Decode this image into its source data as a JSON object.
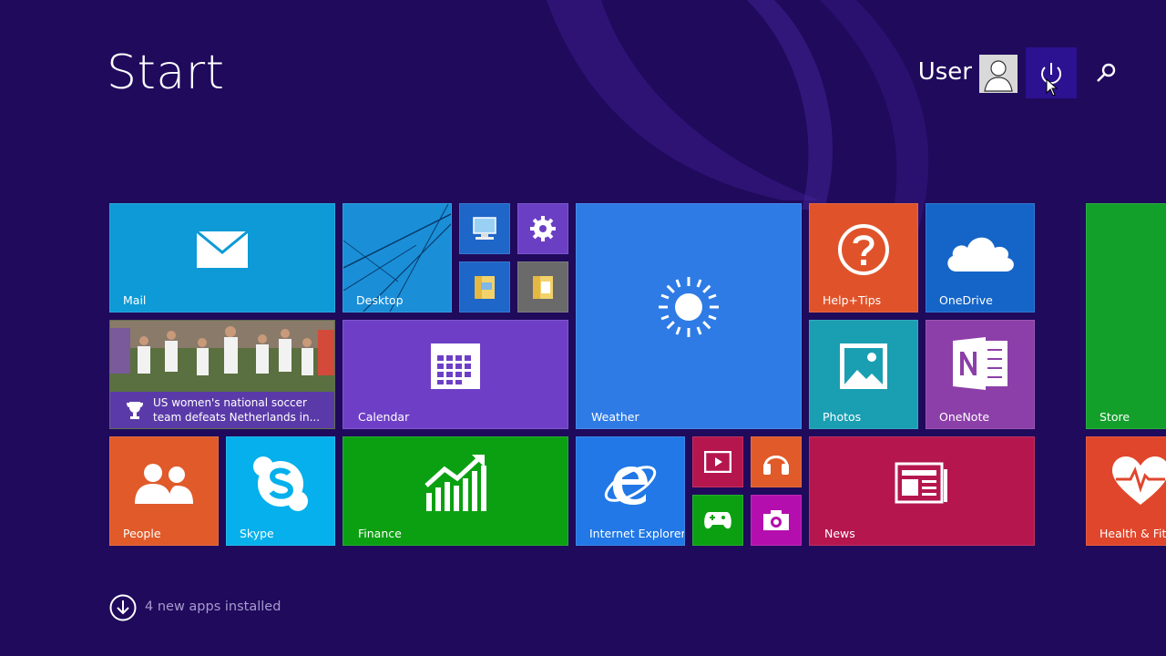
{
  "header": {
    "title": "Start",
    "user_name": "User"
  },
  "tiles": {
    "mail": "Mail",
    "desktop": "Desktop",
    "weather": "Weather",
    "help_tips": "Help+Tips",
    "onedrive": "OneDrive",
    "calendar": "Calendar",
    "photos": "Photos",
    "onenote": "OneNote",
    "store": "Store",
    "people": "People",
    "skype": "Skype",
    "finance": "Finance",
    "internet_explorer": "Internet Explorer",
    "news": "News",
    "health_fitness": "Health & Fitne"
  },
  "news_tile": {
    "headline_line1": "US women's national soccer",
    "headline_line2": "team defeats Netherlands in..."
  },
  "footer": {
    "apps_installed": "4 new apps installed"
  },
  "colors": {
    "background": "#1f0a5c",
    "mail": "#0d9ad6",
    "desktop": "#1a8fd8",
    "weather": "#2e7be5",
    "help_tips": "#e0532a",
    "onedrive": "#1565c8",
    "calendar": "#6e3fc6",
    "photos": "#1a9eb2",
    "onenote": "#8c3fa8",
    "store": "#12a02a",
    "people": "#e05a2a",
    "skype": "#05b0ec",
    "finance": "#0ba012",
    "internet_explorer": "#2178e6",
    "news": "#b5164d",
    "health_fitness": "#e0462b"
  },
  "icons": {
    "mail": "envelope-icon",
    "weather": "sun-icon",
    "help_tips": "question-icon",
    "onedrive": "cloud-icon",
    "calendar": "calendar-icon",
    "photos": "picture-icon",
    "onenote": "onenote-icon",
    "people": "people-icon",
    "skype": "skype-icon",
    "finance": "chart-icon",
    "internet_explorer": "ie-icon",
    "news": "newspaper-icon",
    "health": "heart-icon",
    "power": "power-icon",
    "search": "search-icon"
  }
}
